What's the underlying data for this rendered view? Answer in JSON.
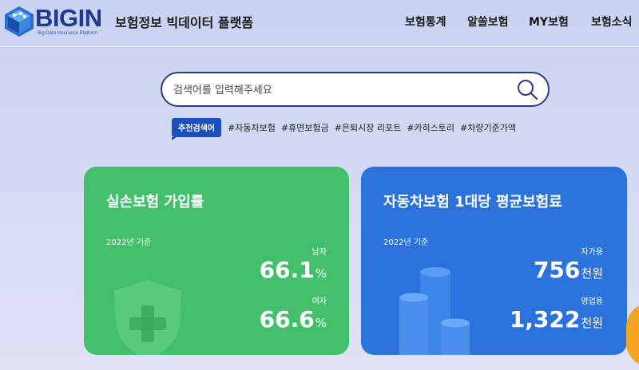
{
  "header": {
    "logo_text": "BIGIN",
    "logo_sub": "Big Data Insurance Platform",
    "tagline": "보험정보 빅데이터 플랫폼",
    "nav": [
      "보험통계",
      "알쏠보험",
      "MY보험",
      "보험소식"
    ]
  },
  "search": {
    "placeholder": "검색어를 입력해주세요",
    "value": ""
  },
  "tags": {
    "label": "추천검색어",
    "items": [
      "#자동차보험",
      "#휴면보험금",
      "#은퇴시장 리포트",
      "#카히스토리",
      "#차량기준가액"
    ]
  },
  "cards": {
    "green": {
      "title": "실손보험 가입률",
      "date": "2022년 기준",
      "stat1_label": "남자",
      "stat1_value": "66.1",
      "stat1_unit": "%",
      "stat2_label": "여자",
      "stat2_value": "66.6",
      "stat2_unit": "%",
      "bg": "#44bf6c"
    },
    "blue": {
      "title": "자동차보험 1대당 평균보험료",
      "date": "2022년 기준",
      "stat1_label": "자가용",
      "stat1_value": "756",
      "stat1_unit": "천원",
      "stat2_label": "영업용",
      "stat2_value": "1,322",
      "stat2_unit": "천원",
      "bg": "#2c72dc"
    }
  },
  "colors": {
    "brand": "#1e3a8a",
    "tag_label": "#1e4fbf",
    "accent": "#f2a623"
  }
}
